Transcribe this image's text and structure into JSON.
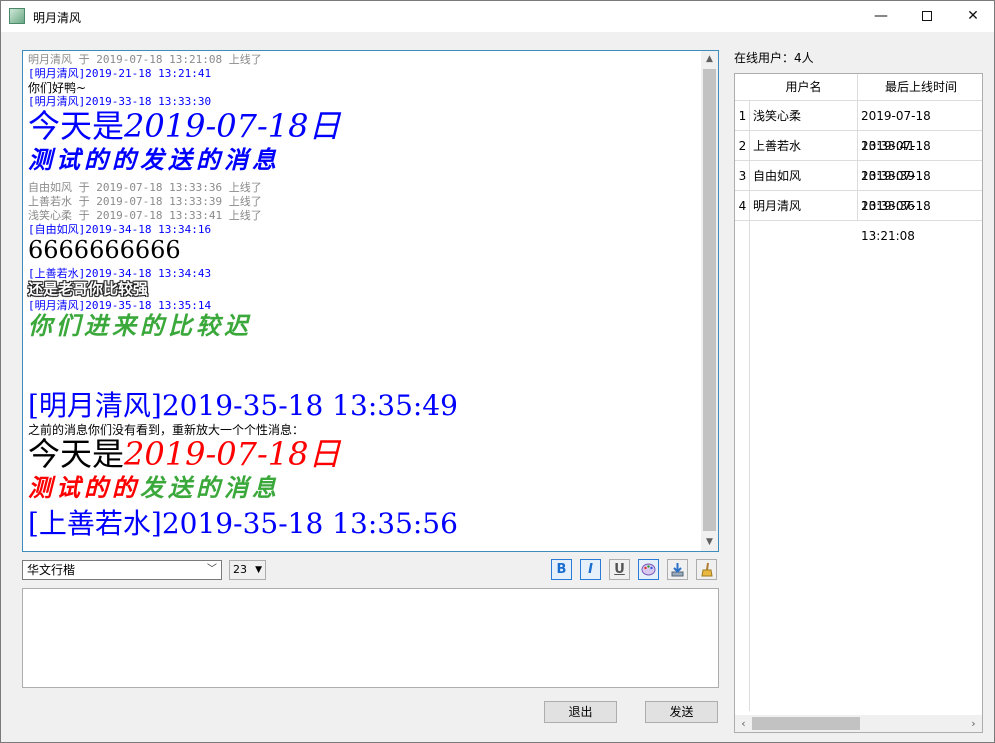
{
  "window": {
    "title": "明月清风"
  },
  "chat": {
    "messages": [
      {
        "kind": "sys",
        "text": "明月清风 于 2019-07-18 13:21:08 上线了"
      },
      {
        "kind": "hdr",
        "text": "[明月清风]2019-21-18 13:21:41"
      },
      {
        "kind": "plain",
        "text": "你们好鸭~"
      },
      {
        "kind": "hdr",
        "text": "[明月清风]2019-33-18 13:33:30"
      },
      {
        "kind": "big",
        "text": "今天是2019-07-18日",
        "color": "#0000ff"
      },
      {
        "kind": "callig",
        "text": "测试的的发送的消息",
        "color": "#0000ff"
      },
      {
        "kind": "sys",
        "text": "自由如风 于 2019-07-18 13:33:36 上线了"
      },
      {
        "kind": "sys",
        "text": "上善若水 于 2019-07-18 13:33:39 上线了"
      },
      {
        "kind": "sys",
        "text": "浅笑心柔 于 2019-07-18 13:33:41 上线了"
      },
      {
        "kind": "hdr",
        "text": "[自由如风]2019-34-18 13:34:16"
      },
      {
        "kind": "num",
        "text": "6666666666",
        "color": "#000000"
      },
      {
        "kind": "hdr",
        "text": "[上善若水]2019-34-18 13:34:43"
      },
      {
        "kind": "outline",
        "text": "还是老哥你比较强",
        "color": "#ffffff"
      },
      {
        "kind": "hdr",
        "text": "[明月清风]2019-35-18 13:35:14"
      },
      {
        "kind": "callig",
        "text": "你们进来的比较迟",
        "color": "#3aa83a"
      },
      {
        "kind": "bighdr",
        "text": "[明月清风]2019-35-18 13:35:49",
        "color": "#0000ff"
      },
      {
        "kind": "plain",
        "text": "之前的消息你们没有看到，重新放大一个个性消息："
      },
      {
        "kind": "mixed",
        "parts": [
          {
            "text": "今天是",
            "color": "#000000",
            "italic": false
          },
          {
            "text": "2019-07-18日",
            "color": "#ff0000",
            "italic": true
          }
        ]
      },
      {
        "kind": "calligmixed",
        "parts": [
          {
            "text": "测试的的",
            "color": "#ff0000"
          },
          {
            "text": "发送的消息",
            "color": "#3aa83a"
          }
        ]
      },
      {
        "kind": "bighdr",
        "text": "[上善若水]2019-35-18 13:35:56",
        "color": "#0000ff"
      }
    ]
  },
  "toolbar": {
    "font_value": "华文行楷",
    "size_value": "23",
    "bold_icon": "B",
    "italic_icon": "I",
    "underline_icon": "U"
  },
  "buttons": {
    "exit_label": "退出",
    "send_label": "发送"
  },
  "online": {
    "label": "在线用户：4人",
    "columns": [
      "用户名",
      "最后上线时间"
    ],
    "rows": [
      {
        "num": "1",
        "name": "浅笑心柔",
        "time": "2019-07-18 13:33:41"
      },
      {
        "num": "2",
        "name": "上善若水",
        "time": "2019-07-18 13:33:39"
      },
      {
        "num": "3",
        "name": "自由如风",
        "time": "2019-07-18 13:33:36"
      },
      {
        "num": "4",
        "name": "明月清风",
        "time": "2019-07-18 13:21:08"
      }
    ]
  }
}
